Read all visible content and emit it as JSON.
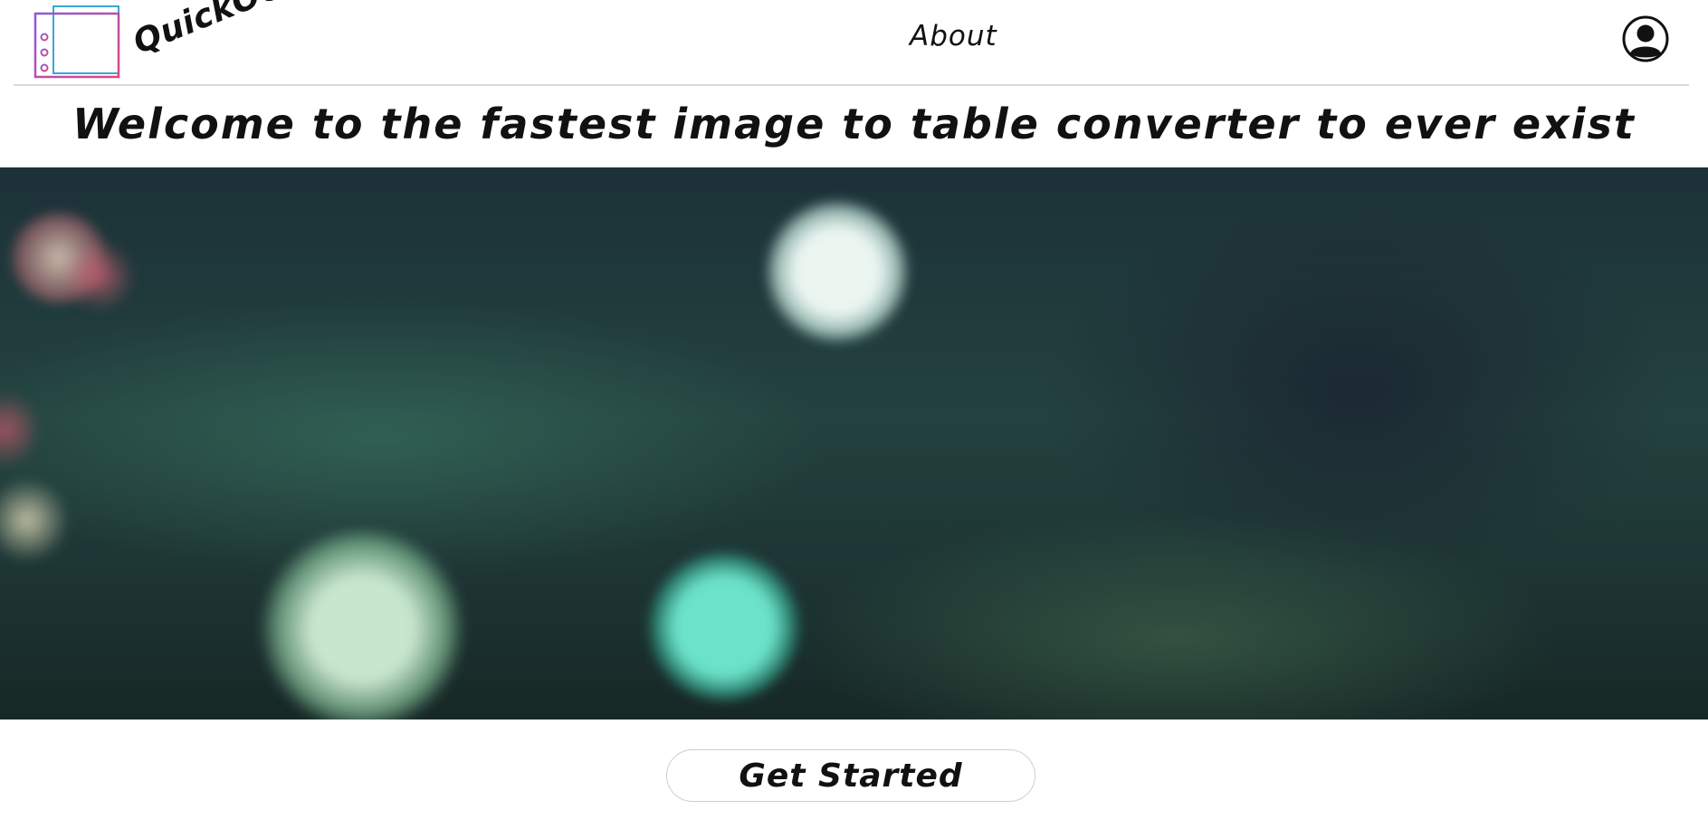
{
  "nav": {
    "logo_text": "QuickOCR",
    "logo_icon": "table-icon",
    "about_label": "About",
    "profile_icon": "user-profile-icon"
  },
  "main": {
    "headline": "Welcome to the fastest image to table converter to ever exist",
    "cta_label": "Get Started"
  },
  "colors": {
    "logo_gradient_start": "#8a5bd6",
    "logo_gradient_end": "#e2457f",
    "logo_accent": "#3aa6d8",
    "text": "#111111",
    "divider": "#d9d9d9"
  }
}
